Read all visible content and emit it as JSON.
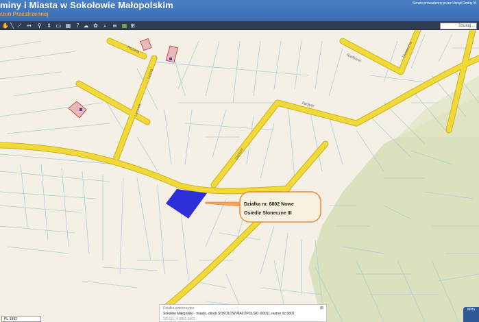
{
  "header": {
    "title": "miny i Miasta w Sokołowie Małopolskim",
    "subtitle": "rzeń Przestrzennej",
    "service_note": "Serwis prowadzony przez Urząd Gminy M"
  },
  "toolbar": {
    "tools": [
      "hand-icon",
      "measure-line-icon",
      "measure-area-icon",
      "zoom-extent-icon",
      "info-icon",
      "print-icon",
      "layers-icon",
      "help-icon",
      "select-icon",
      "settings-icon",
      "search-map-icon",
      "coordinates-icon",
      "legend-icon",
      "home-icon"
    ],
    "search_placeholder": "Szukaj..."
  },
  "map": {
    "colors": {
      "background": "#f4f0e6",
      "road": "#f2d93a",
      "road_edge": "#c9b21c",
      "parcel_line": "#a8cfd8",
      "forest": "#d9dfb8",
      "highlight_parcel": "#2d2fd8",
      "callout_border": "#e88a3a",
      "building": "#e8b8b8",
      "building_edge": "#b03030"
    },
    "streets": [
      "Różana",
      "Leśna",
      "Radosna",
      "Słoneczna",
      "Zacisze",
      "Zacisze",
      "Lecowa"
    ],
    "callout": {
      "line1": "Działka nr. 6802 Nowe",
      "line2": "Osiedle Słoneczne III"
    }
  },
  "info_popup": {
    "title": "Działka ewidencyjna",
    "line": "Sokołów Małopolski - miasto, obręb SOKOŁÓW MAŁOPOLSKI (0001), numer dz 6802",
    "id": "181611_4.0001.6802",
    "close": "⊠"
  },
  "scale": {
    "value": "PL-1992"
  },
  "corner_button": {
    "label": "Wirtu"
  }
}
